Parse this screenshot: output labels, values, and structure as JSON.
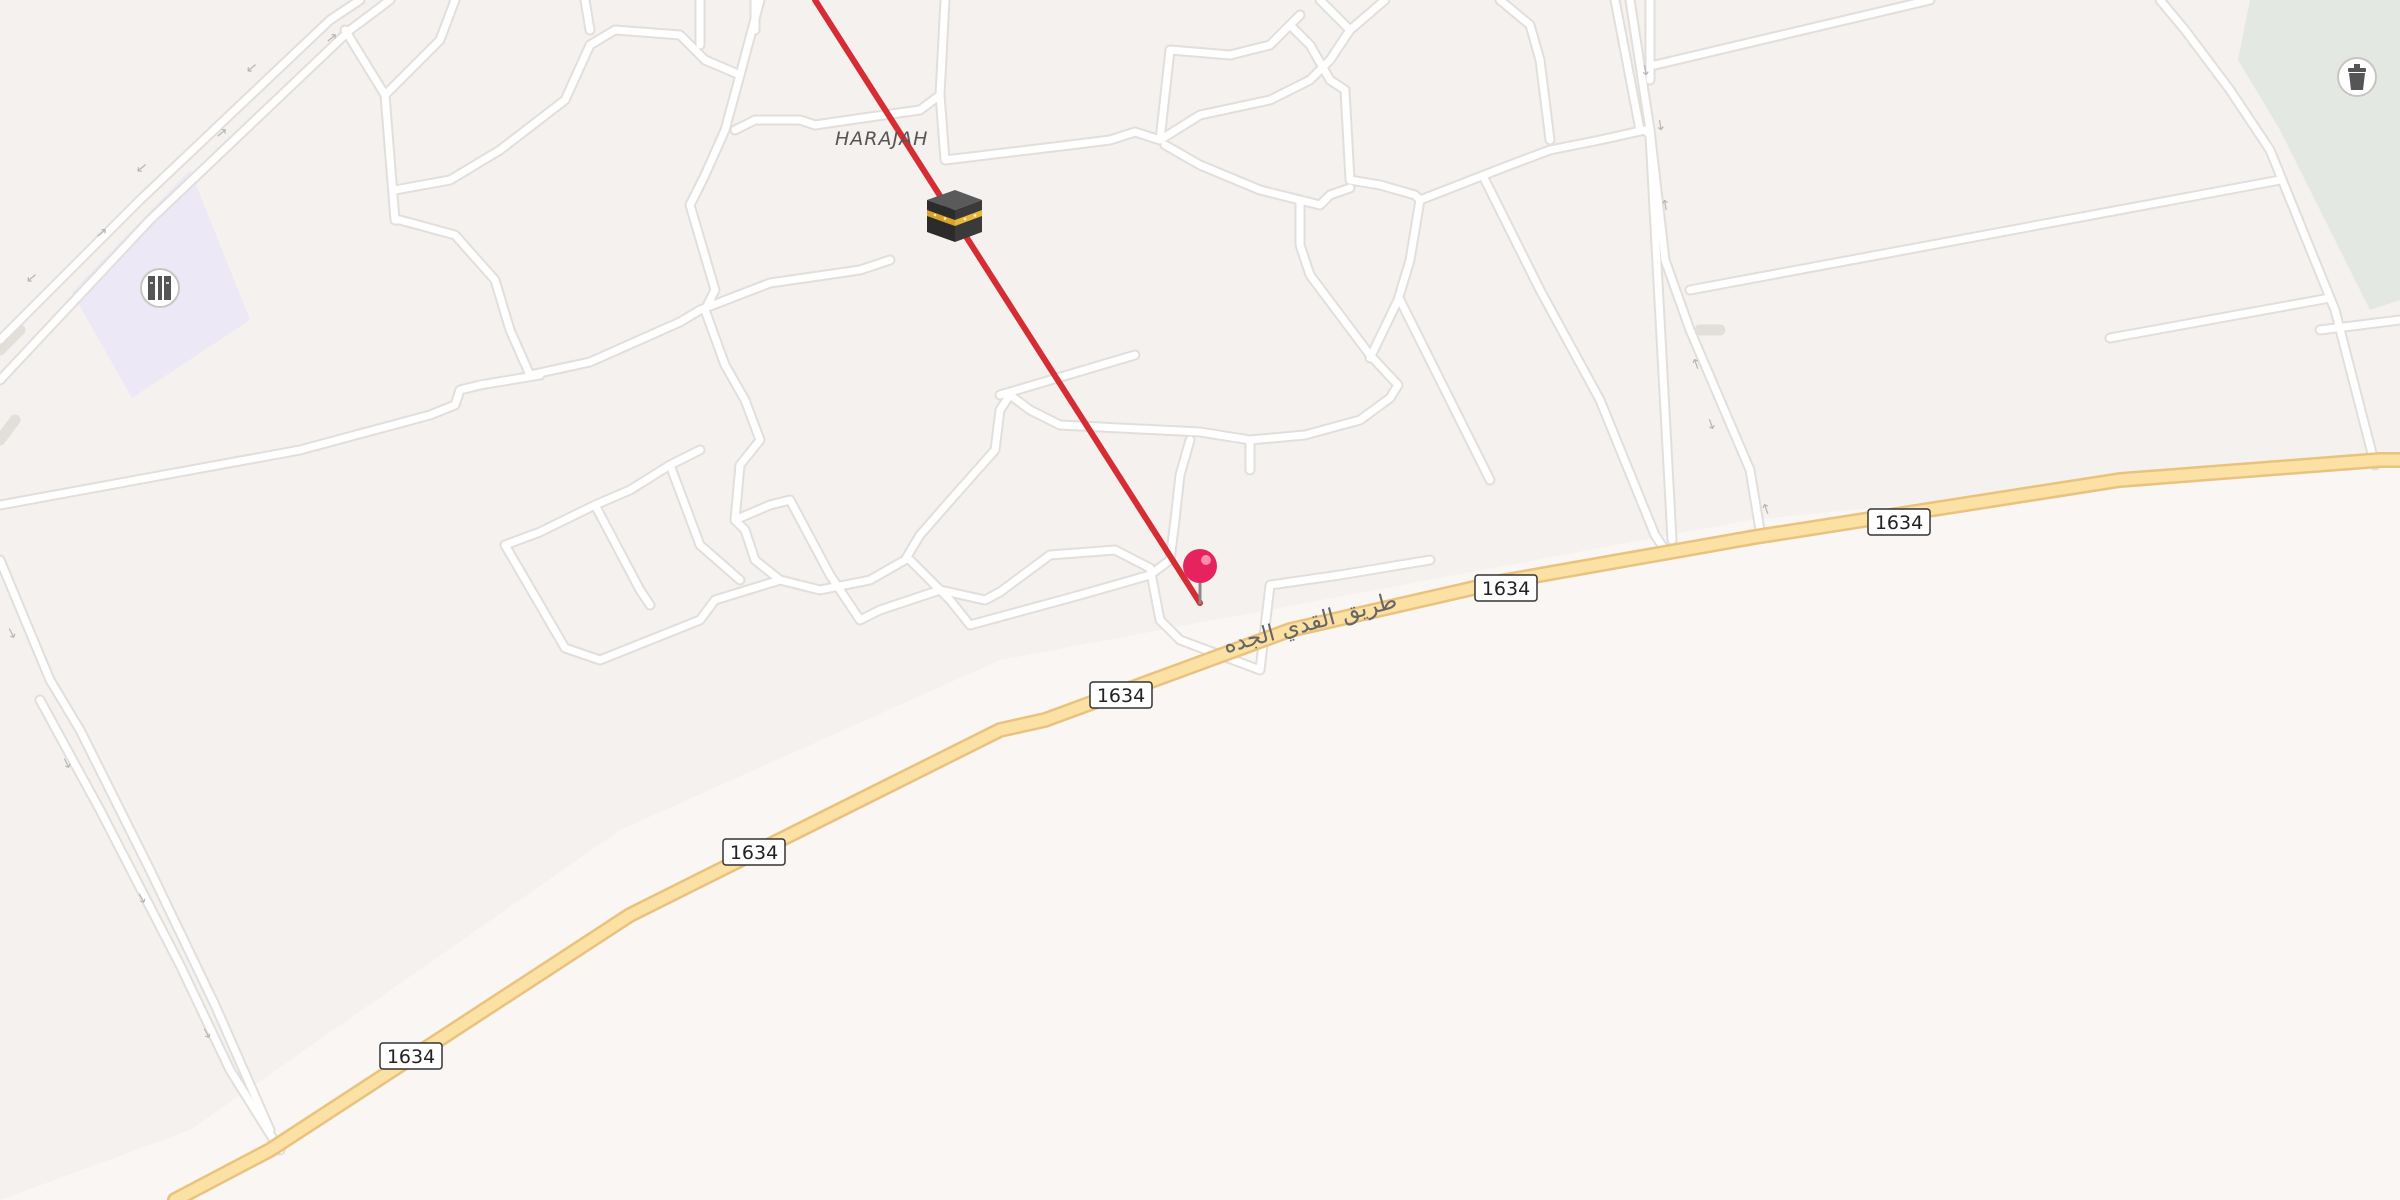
{
  "map": {
    "place_label": "HARAJAH",
    "road_name": "طريق القدي الجده",
    "route_shields": [
      "1634",
      "1634",
      "1634",
      "1634",
      "1634"
    ],
    "colors": {
      "background": "#f9f6f3",
      "residential": "#f4f1ee",
      "minor_road": "#ffffff",
      "minor_road_casing": "#e3e0dc",
      "major_road": "#fbe1a4",
      "major_road_casing": "#eac27d",
      "route_line": "#d62c33",
      "pin": "#e6225f",
      "park": "#e4e8e2",
      "school_area": "#ece8f6"
    },
    "icons": {
      "landmark": "kaaba-icon",
      "poi_left": "library-icon",
      "poi_right": "waste-basket-icon",
      "destination": "map-pin-icon"
    }
  }
}
